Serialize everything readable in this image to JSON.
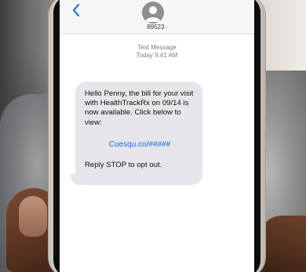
{
  "header": {
    "contact_number": "89523",
    "contact_chevron": "›",
    "back_icon": "chevron-left-icon",
    "avatar_icon": "person-icon"
  },
  "thread": {
    "message_type": "Text Message",
    "timestamp": "Today 9:41 AM"
  },
  "message": {
    "body": "Hello Penny, the bill for your visit with HealthTrackRx on 09/14 is now available. Click below to view:",
    "link": "Cuesqu.co/#####",
    "opt_out": "Reply STOP to opt out."
  },
  "colors": {
    "bubble": "#e5e5ea",
    "link": "#1f6fdc",
    "nav_accent": "#2b74d6"
  }
}
